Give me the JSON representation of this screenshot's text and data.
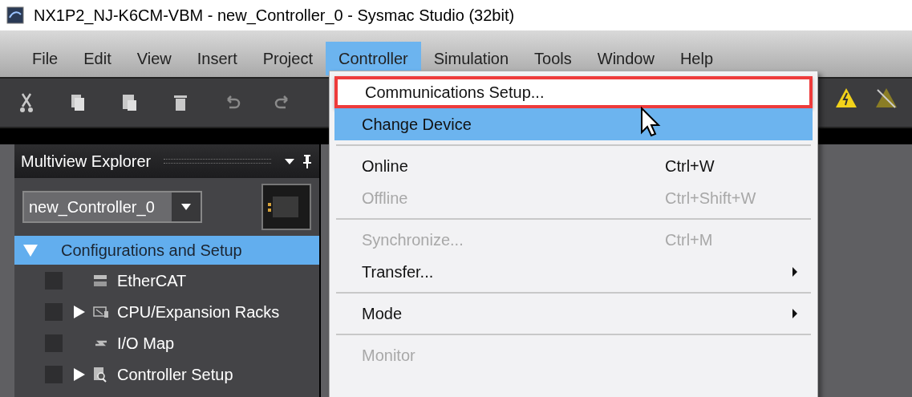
{
  "window": {
    "title": "NX1P2_NJ-K6CM-VBM - new_Controller_0 - Sysmac Studio (32bit)"
  },
  "menu_bar": [
    {
      "label": "File",
      "selected": false
    },
    {
      "label": "Edit",
      "selected": false
    },
    {
      "label": "View",
      "selected": false
    },
    {
      "label": "Insert",
      "selected": false
    },
    {
      "label": "Project",
      "selected": false
    },
    {
      "label": "Controller",
      "selected": true
    },
    {
      "label": "Simulation",
      "selected": false
    },
    {
      "label": "Tools",
      "selected": false
    },
    {
      "label": "Window",
      "selected": false
    },
    {
      "label": "Help",
      "selected": false
    }
  ],
  "explorer": {
    "title": "Multiview Explorer",
    "controller_select": "new_Controller_0",
    "tree": [
      {
        "label": "Configurations and Setup",
        "expanded": true,
        "selected": true,
        "children": [
          {
            "label": "EtherCAT",
            "expandable": false
          },
          {
            "label": "CPU/Expansion Racks",
            "expandable": true
          },
          {
            "label": "I/O Map",
            "expandable": false
          },
          {
            "label": "Controller Setup",
            "expandable": true
          }
        ]
      }
    ]
  },
  "menu": [
    {
      "kind": "item",
      "label": "Communications Setup...",
      "disabled": false,
      "highlighted": false,
      "outlined": true
    },
    {
      "kind": "item",
      "label": "Change Device",
      "disabled": false,
      "highlighted": true,
      "outlined": false
    },
    {
      "kind": "separator"
    },
    {
      "kind": "item",
      "label": "Online",
      "shortcut": "Ctrl+W",
      "disabled": false,
      "highlighted": false,
      "outlined": false
    },
    {
      "kind": "item",
      "label": "Offline",
      "shortcut": "Ctrl+Shift+W",
      "disabled": true,
      "highlighted": false,
      "outlined": false
    },
    {
      "kind": "separator"
    },
    {
      "kind": "item",
      "label": "Synchronize...",
      "shortcut": "Ctrl+M",
      "disabled": true,
      "highlighted": false,
      "outlined": false
    },
    {
      "kind": "item",
      "label": "Transfer...",
      "submenu": true,
      "disabled": false,
      "highlighted": false,
      "outlined": false
    },
    {
      "kind": "separator"
    },
    {
      "kind": "item",
      "label": "Mode",
      "submenu": true,
      "disabled": false,
      "highlighted": false,
      "outlined": false
    },
    {
      "kind": "separator"
    },
    {
      "kind": "item",
      "label": "Monitor",
      "disabled": true,
      "highlighted": false,
      "outlined": false
    }
  ]
}
